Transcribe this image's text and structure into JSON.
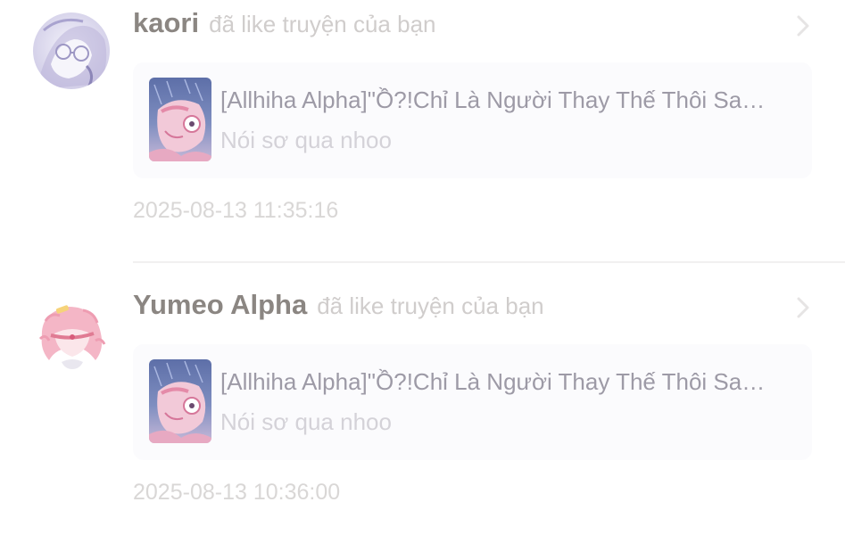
{
  "notifications": [
    {
      "username": "kaori",
      "action": "đã like truyện của bạn",
      "avatar_icon": "avatar-kaori",
      "story": {
        "title": "[Allhiha Alpha]\"Ồ?!Chỉ Là Người Thay Thế Thôi Sa…",
        "snippet": "Nói sơ qua nhoo",
        "cover_icon": "story-cover"
      },
      "timestamp": "2025-08-13 11:35:16"
    },
    {
      "username": "Yumeo Alpha",
      "action": "đã like truyện của bạn",
      "avatar_icon": "avatar-yumeo",
      "story": {
        "title": "[Allhiha Alpha]\"Ồ?!Chỉ Là Người Thay Thế Thôi Sa…",
        "snippet": "Nói sơ qua nhoo",
        "cover_icon": "story-cover"
      },
      "timestamp": "2025-08-13 10:36:00"
    }
  ],
  "colors": {
    "username": "#8b8682",
    "action": "#d0cdcc",
    "story_title": "#9d9aa6",
    "snippet": "#d4d2d8",
    "timestamp": "#d9d7d6",
    "card_bg": "#fbfbfd",
    "divider": "#f1f0f0",
    "chevron": "#e6e4e4"
  }
}
